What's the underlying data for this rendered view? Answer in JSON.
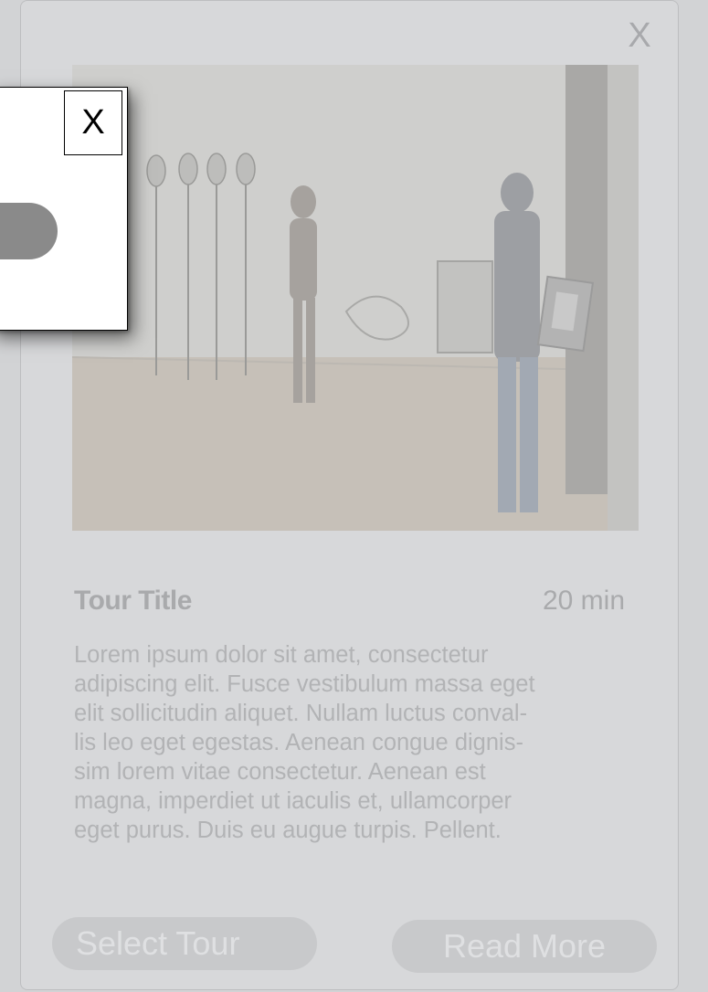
{
  "card": {
    "close_label": "X",
    "image_alt": "museum-gallery-photo",
    "title": "Tour Title",
    "duration": "20 min",
    "description_lines": [
      "Lorem ipsum dolor sit amet, consectetur",
      "adipiscing elit. Fusce vestibulum massa eget",
      "elit sollicitudin aliquet. Nullam luctus conval-",
      "lis leo eget egestas. Aenean congue dignis-",
      "sim lorem vitae consectetur. Aenean est",
      "magna, imperdiet ut iaculis et, ullamcorper",
      "eget purus. Duis eu augue turpis. Pellent."
    ],
    "select_label": "Select Tour",
    "read_more_label": "Read More"
  },
  "dialog": {
    "close_label": "X"
  },
  "colors": {
    "overlay_bg": "#d2d3d5",
    "card_text": "#a9aaac",
    "dialog_pill": "#8a8a8a"
  }
}
